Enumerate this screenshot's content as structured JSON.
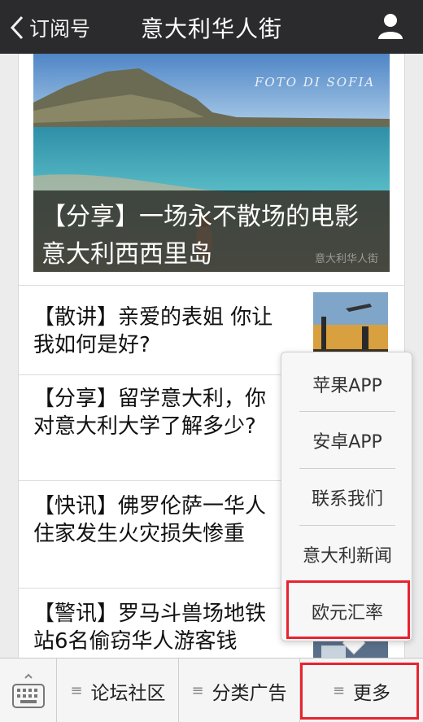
{
  "navbar": {
    "back_label": "订阅号",
    "title": "意大利华人街",
    "back_icon": "chevron-left-icon",
    "user_icon": "person-icon"
  },
  "hero": {
    "title": "【分享】一场永不散场的电影 意大利西西里岛",
    "photo_credit": "FOTO DI SOFIA",
    "watermark": "意大利华人街"
  },
  "articles": [
    {
      "title": "【散讲】亲爱的表姐 你让我如何是好?"
    },
    {
      "title": "【分享】留学意大利，你对意大利大学了解多少?"
    },
    {
      "title": "【快讯】佛罗伦萨一华人住家发生火灾损失惨重"
    },
    {
      "title": "【警讯】罗马斗兽场地铁站6名偷窃华人游客钱"
    }
  ],
  "popup_menu": {
    "items": [
      {
        "label": "苹果APP"
      },
      {
        "label": "安卓APP"
      },
      {
        "label": "联系我们"
      },
      {
        "label": "意大利新闻"
      },
      {
        "label": "欧元汇率",
        "highlighted": true
      }
    ]
  },
  "tabbar": {
    "keyboard_icon": "keyboard-icon",
    "tabs": [
      {
        "label": "论坛社区"
      },
      {
        "label": "分类广告"
      },
      {
        "label": "更多",
        "highlighted": true
      }
    ]
  },
  "colors": {
    "navbar_bg": "#2b2b2d",
    "highlight": "#e8232f"
  }
}
